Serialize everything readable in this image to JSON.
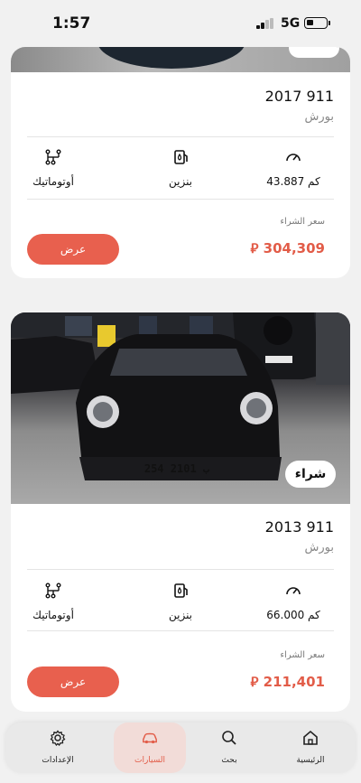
{
  "status_bar": {
    "time": "1:57",
    "network": "5G"
  },
  "listings": [
    {
      "title": "2017 911",
      "brand": "بورش",
      "mileage": "43.887 كم",
      "fuel": "بنزين",
      "transmission": "أوتوماتيك",
      "price_label": "سعر الشراء",
      "price": "304,309 ⃁",
      "offer_button": "عرض"
    },
    {
      "title": "2013 911",
      "brand": "بورش",
      "mileage": "66.000 كم",
      "fuel": "بنزين",
      "transmission": "أوتوماتيك",
      "price_label": "سعر الشراء",
      "price": "211,401 ⃁",
      "offer_button": "عرض",
      "badge": "شراء",
      "plate": "254 ب 2101"
    }
  ],
  "tab_bar": {
    "items": [
      {
        "label": "الرئيسية",
        "icon": "home-icon"
      },
      {
        "label": "بحث",
        "icon": "search-icon"
      },
      {
        "label": "السيارات",
        "icon": "car-icon",
        "active": true
      },
      {
        "label": "الإعدادات",
        "icon": "gear-icon"
      }
    ]
  },
  "colors": {
    "accent": "#e8604e",
    "price": "#e25c48",
    "background": "#f1f1f1"
  }
}
